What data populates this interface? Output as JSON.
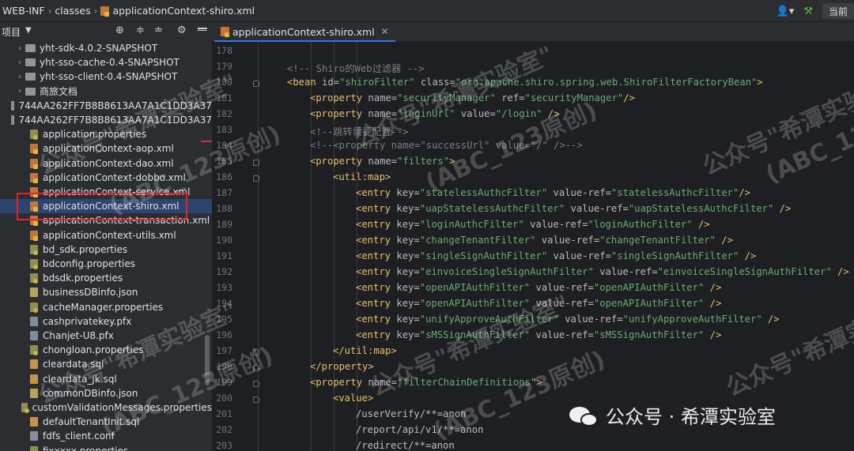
{
  "breadcrumb": {
    "items": [
      "WEB-INF",
      "classes",
      "applicationContext-shiro.xml"
    ],
    "current_label": "当前"
  },
  "project_panel": {
    "title": "项目",
    "tree": [
      {
        "label": "yht-sdk-4.0.2-SNAPSHOT",
        "type": "folder"
      },
      {
        "label": "yht-sso-cache-0.4-SNAPSHOT",
        "type": "folder"
      },
      {
        "label": "yht-sso-client-0.4-SNAPSHOT",
        "type": "folder"
      },
      {
        "label": "商旅文档",
        "type": "folder"
      },
      {
        "label": "744AA262FF7B8B8613AA7A1C1DD3A37",
        "type": "gen"
      },
      {
        "label": "744AA262FF7B8B8613AA7A1C1DD3A37",
        "type": "gen"
      },
      {
        "label": "application.properties",
        "type": "props"
      },
      {
        "label": "applicationContext-aop.xml",
        "type": "xml"
      },
      {
        "label": "applicationContext-dao.xml",
        "type": "xml"
      },
      {
        "label": "applicationContext-dobbo.xml",
        "type": "xml"
      },
      {
        "label": "applicationContext-service.xml",
        "type": "xml"
      },
      {
        "label": "applicationContext-shiro.xml",
        "type": "xml"
      },
      {
        "label": "applicationContext-transaction.xml",
        "type": "xml"
      },
      {
        "label": "applicationContext-utils.xml",
        "type": "xml"
      },
      {
        "label": "bd_sdk.properties",
        "type": "props"
      },
      {
        "label": "bdconfig.properties",
        "type": "props"
      },
      {
        "label": "bdsdk.properties",
        "type": "props"
      },
      {
        "label": "businessDBinfo.json",
        "type": "json"
      },
      {
        "label": "cacheManager.properties",
        "type": "props"
      },
      {
        "label": "cashprivatekey.pfx",
        "type": "pfx"
      },
      {
        "label": "Chanjet-U8.pfx",
        "type": "pfx"
      },
      {
        "label": "chongloan.properties",
        "type": "props"
      },
      {
        "label": "cleardata.sql",
        "type": "sql"
      },
      {
        "label": "cleardata_jk.sql",
        "type": "sql"
      },
      {
        "label": "commonDBinfo.json",
        "type": "json"
      },
      {
        "label": "customValidationMessages.properties",
        "type": "props"
      },
      {
        "label": "defaultTenantInit.sql",
        "type": "sql"
      },
      {
        "label": "fdfs_client.conf",
        "type": "conf"
      },
      {
        "label": "fixxxxx.properties",
        "type": "props"
      }
    ]
  },
  "editor": {
    "tab_label": "applicationContext-shiro.xml",
    "line_numbers": [
      "178",
      "179",
      "180",
      "181",
      "182",
      "183",
      "184",
      "185",
      "186",
      "187",
      "188",
      "189",
      "190",
      "191",
      "192",
      "193",
      "194",
      "195",
      "196",
      "197",
      "198",
      "199",
      "200",
      "201",
      "202",
      "203"
    ],
    "lines": {
      "l179": "<!-- Shiro的Web过滤器 -->",
      "l180_tag": "bean",
      "l180_a1": "id",
      "l180_v1": "\"shiroFilter\"",
      "l180_a2": "class",
      "l180_v2": "\"org.apache.shiro.spring.web.ShiroFilterFactoryBean\"",
      "l181_v1": "\"securityManager\"",
      "l181_v2": "\"securityManager\"",
      "l182_v1": "\"loginUrl\"",
      "l182_v2": "\"/login\"",
      "l183": "<!--跳转需要配置-->",
      "l184": "<!--<property name=\"successUrl\" value=\"/\" />-->",
      "l185_v": "\"filters\"",
      "l186": "util:map",
      "entries": [
        {
          "key": "\"statelessAuthcFilter\"",
          "ref": "\"statelessAuthcFilter\"",
          "close": "/>"
        },
        {
          "key": "\"uapStatelessAuthcFilter\"",
          "ref": "\"uapStatelessAuthcFilter\"",
          "close": " />"
        },
        {
          "key": "\"loginAuthcFilter\"",
          "ref": "\"loginAuthcFilter\"",
          "close": " />"
        },
        {
          "key": "\"changeTenantFilter\"",
          "ref": "\"changeTenantFilter\"",
          "close": " />"
        },
        {
          "key": "\"singleSignAuthFilter\"",
          "ref": "\"singleSignAuthFilter\"",
          "close": " />"
        },
        {
          "key": "\"einvoiceSingleSignAuthFilter\"",
          "ref": "\"einvoiceSingleSignAuthFilter\"",
          "close": " />"
        },
        {
          "key": "\"openAPIAuthFilter\"",
          "ref": "\"openAPIAuthFilter\"",
          "close": " />"
        },
        {
          "key": "\"openAPIAuthFilter\"",
          "ref": "\"openAPIAuthFilter\"",
          "close": " />"
        },
        {
          "key": "\"unifyApproveAuthFilter\"",
          "ref": "\"unifyApproveAuthFilter\"",
          "close": " />"
        },
        {
          "key": "\"sMSSignAuthFilter\"",
          "ref": "\"sMSSignAuthFilter\"",
          "close": " />"
        }
      ],
      "l197": "</util:map>",
      "l198": "</property>",
      "l199_v": "\"filterChainDefinitions\"",
      "l200": "<value>",
      "l201": "/userVerify/**=anon",
      "l202": "/report/api/v1/**=anon",
      "l203": "/redirect/**=anon"
    }
  },
  "watermark": {
    "text1": "公众号\"希潭实验室\"",
    "text2": "(ABC_123原创)",
    "brand": "公众号 · 希潭实验室"
  }
}
